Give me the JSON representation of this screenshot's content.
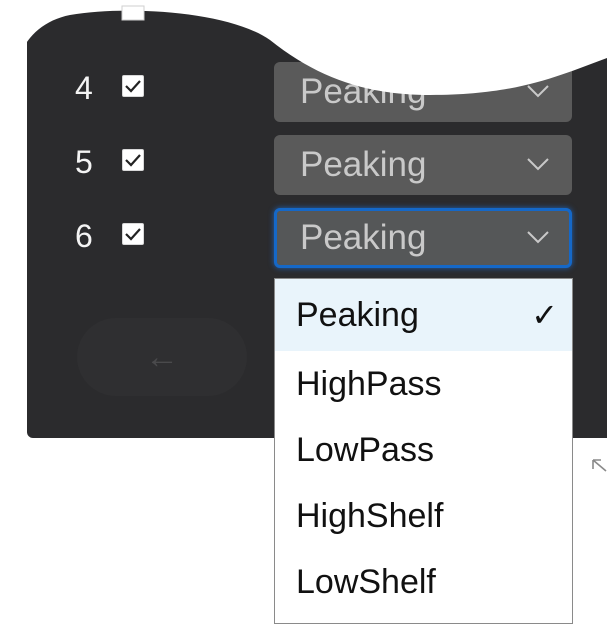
{
  "rows": [
    {
      "number": "4",
      "checked": true,
      "filter": "Peaking"
    },
    {
      "number": "5",
      "checked": true,
      "filter": "Peaking"
    },
    {
      "number": "6",
      "checked": true,
      "filter": "Peaking"
    }
  ],
  "back_button": {
    "icon": "left-arrow-icon",
    "label": "←"
  },
  "dropdown": {
    "options": [
      {
        "label": "Peaking",
        "selected": true,
        "check_mark": "✓"
      },
      {
        "label": "HighPass",
        "selected": false
      },
      {
        "label": "LowPass",
        "selected": false
      },
      {
        "label": "HighShelf",
        "selected": false
      },
      {
        "label": "LowShelf",
        "selected": false
      }
    ]
  },
  "colors": {
    "panel_bg": "#2b2b2d",
    "select_bg": "#5a5a5a",
    "focus_ring": "#1568c8",
    "selected_option_bg": "#e9f4fb"
  }
}
